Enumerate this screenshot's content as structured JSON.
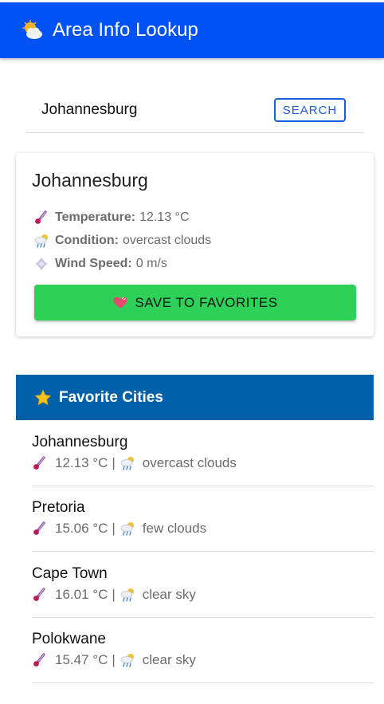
{
  "app": {
    "title": "Area Info Lookup",
    "logo_icon": "sun-behind-cloud-icon",
    "primary_color": "#0052f5"
  },
  "search": {
    "value": "Johannesburg",
    "button_label": "SEARCH"
  },
  "weather_card": {
    "city": "Johannesburg",
    "temperature_label": "Temperature:",
    "temperature_value": "12.13 °C",
    "condition_label": "Condition:",
    "condition_value": "overcast clouds",
    "wind_label": "Wind Speed:",
    "wind_value": "0 m/s",
    "save_label": "SAVE TO FAVORITES",
    "save_color": "#2ed158"
  },
  "favorites": {
    "title": "Favorite Cities",
    "header_color": "#0060a8",
    "items": [
      {
        "name": "Johannesburg",
        "temp": "12.13 °C",
        "condition": "overcast clouds"
      },
      {
        "name": "Pretoria",
        "temp": "15.06 °C",
        "condition": "few clouds"
      },
      {
        "name": "Cape Town",
        "temp": "16.01 °C",
        "condition": "clear sky"
      },
      {
        "name": "Polokwane",
        "temp": "15.47 °C",
        "condition": "clear sky"
      }
    ]
  }
}
